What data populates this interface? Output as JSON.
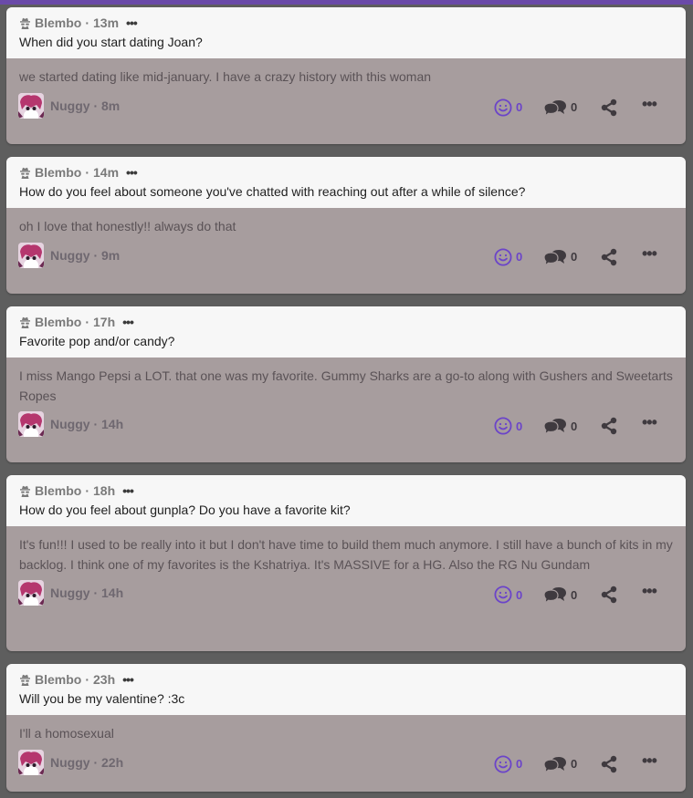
{
  "posts": [
    {
      "asker": "Blembo",
      "asked_time": "13m",
      "question": "When did you start dating Joan?",
      "answer": "we started dating like mid-january. I have a crazy history with this woman",
      "answerer": "Nuggy",
      "answered_time": "8m",
      "reactions": "0",
      "comments": "0"
    },
    {
      "asker": "Blembo",
      "asked_time": "14m",
      "question": "How do you feel about someone you've chatted with reaching out after a while of silence?",
      "answer": "oh I love that honestly!! always do that",
      "answerer": "Nuggy",
      "answered_time": "9m",
      "reactions": "0",
      "comments": "0"
    },
    {
      "asker": "Blembo",
      "asked_time": "17h",
      "question": "Favorite pop and/or candy?",
      "answer": "I miss Mango Pepsi a LOT. that one was my favorite. Gummy Sharks are a go-to along with Gushers and Sweetarts Ropes",
      "answerer": "Nuggy",
      "answered_time": "14h",
      "reactions": "0",
      "comments": "0"
    },
    {
      "asker": "Blembo",
      "asked_time": "18h",
      "question": "How do you feel about gunpla? Do you have a favorite kit?",
      "answer": "It's fun!!! I used to be really into it but I don't have time to build them much anymore. I still have a bunch of kits in my backlog. I think one of my favorites is the Kshatriya. It's MASSIVE for a HG. Also the RG Nu Gundam",
      "answerer": "Nuggy",
      "answered_time": "14h",
      "reactions": "0",
      "comments": "0"
    },
    {
      "asker": "Blembo",
      "asked_time": "23h",
      "question": "Will you be my valentine? :3c",
      "answer": "I'll a homosexual",
      "answerer": "Nuggy",
      "answered_time": "22h",
      "reactions": "0",
      "comments": "0"
    }
  ],
  "separator": "·",
  "more_glyph": "•••",
  "colors": {
    "accent": "#6b44c9",
    "top_bar": "#6a4aa8",
    "answer_bg": "#a79d9e",
    "question_bg": "#f7f7f7",
    "page_bg": "#5e5e5e"
  },
  "icons": {
    "anon": "anonymous-spy-icon",
    "react": "smiley-face-icon",
    "comment": "speech-bubbles-icon",
    "share": "share-icon",
    "more": "more-dots-icon"
  }
}
